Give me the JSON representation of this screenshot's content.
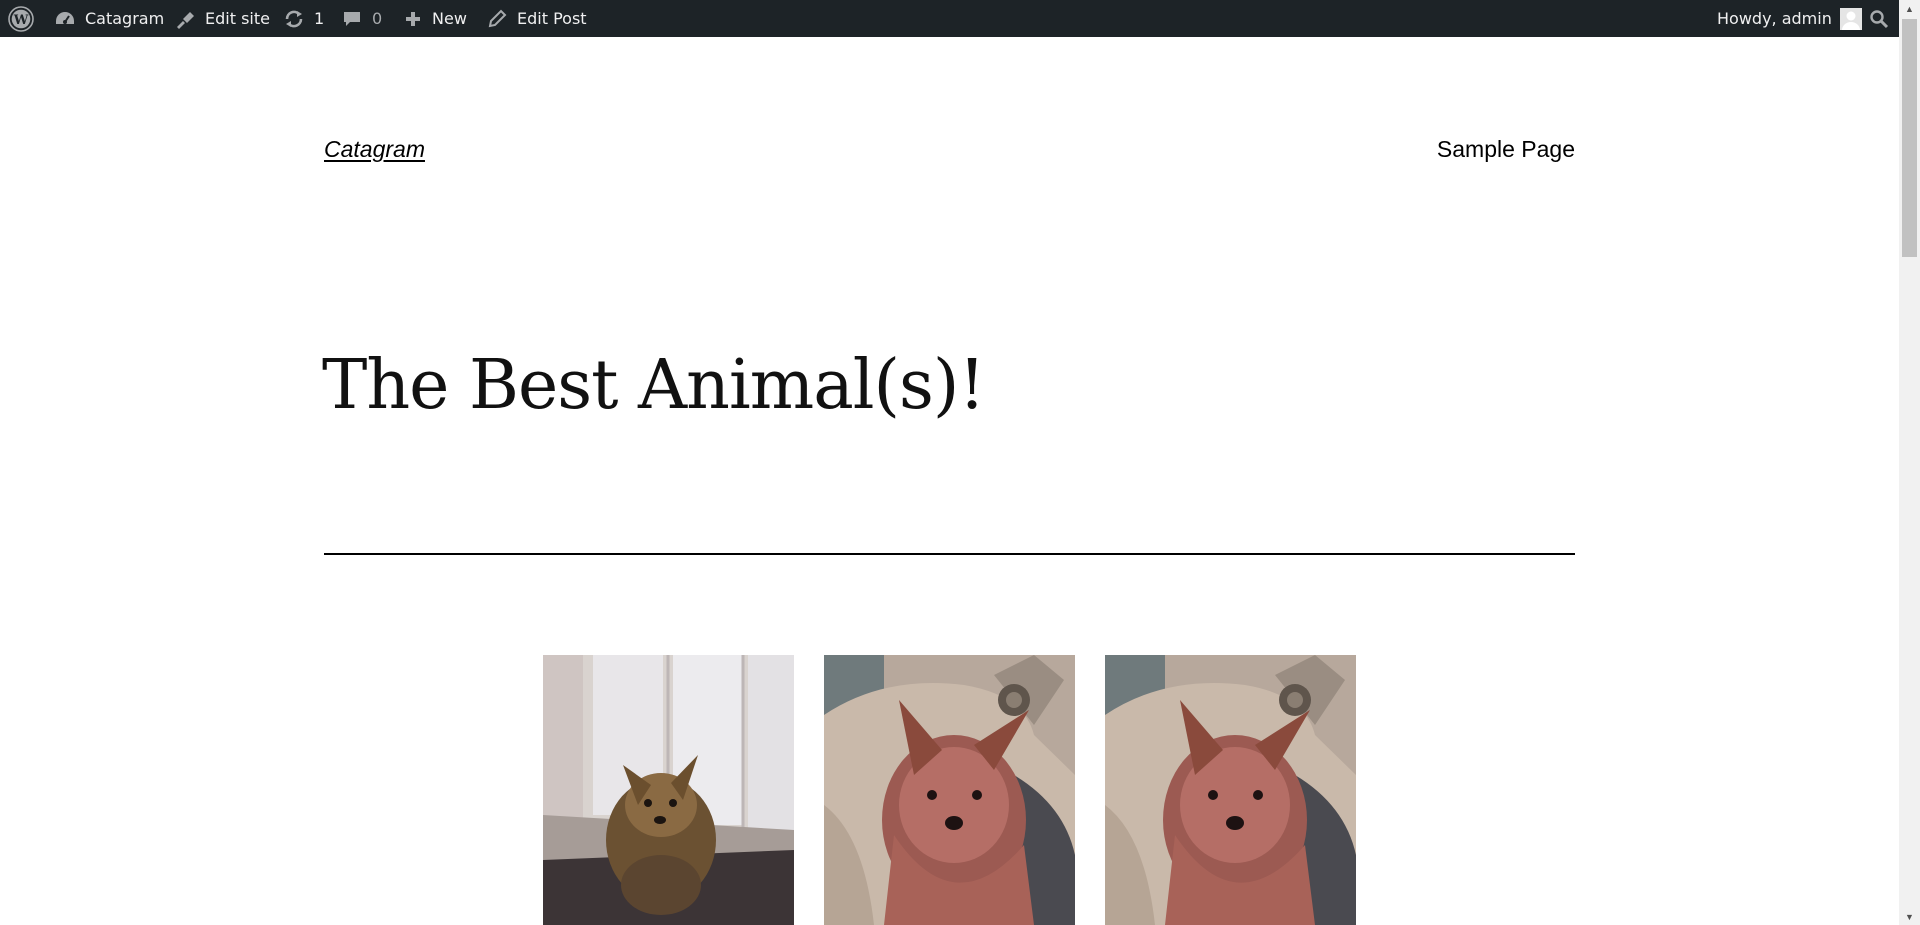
{
  "adminbar": {
    "site_name": "Catagram",
    "edit_site": "Edit site",
    "updates_count": "1",
    "comments_count": "0",
    "new_label": "New",
    "edit_post": "Edit Post",
    "howdy": "Howdy, admin"
  },
  "header": {
    "site_title": "Catagram",
    "nav_items": [
      "Sample Page"
    ]
  },
  "post": {
    "title": "The Best Animal(s)!"
  },
  "gallery": {
    "images": [
      {
        "icon": "yorkie-photo-hallway"
      },
      {
        "icon": "yorkie-photo-couch"
      },
      {
        "icon": "yorkie-photo-couch"
      }
    ]
  },
  "colors": {
    "adminbar_bg": "#1d2327",
    "adminbar_text": "#f0f0f1",
    "page_bg": "#ffffff",
    "text": "#000000"
  }
}
